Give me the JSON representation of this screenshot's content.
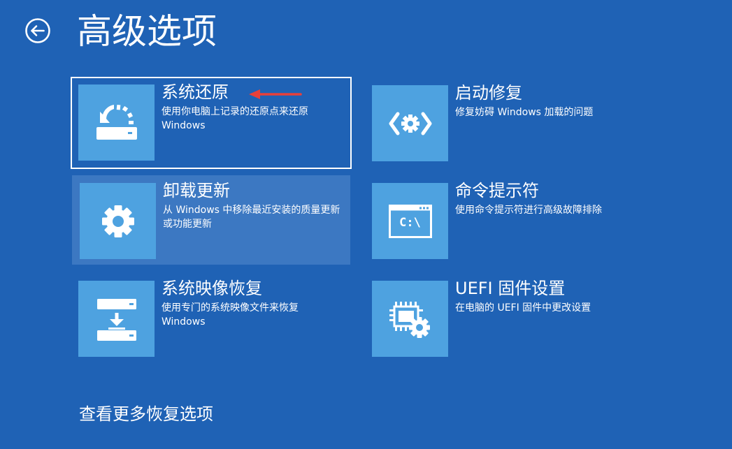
{
  "page": {
    "title": "高级选项",
    "back_icon": "back-arrow-circle-icon"
  },
  "options": [
    {
      "id": "system-restore",
      "title": "系统还原",
      "description": "使用你电脑上记录的还原点来还原 Windows",
      "icon": "system-restore-icon",
      "state": "selected"
    },
    {
      "id": "startup-repair",
      "title": "启动修复",
      "description": "修复妨碍 Windows 加载的问题",
      "icon": "startup-repair-icon",
      "state": "normal"
    },
    {
      "id": "uninstall-updates",
      "title": "卸载更新",
      "description": "从 Windows 中移除最近安装的质量更新或功能更新",
      "icon": "gear-icon",
      "state": "hovered"
    },
    {
      "id": "command-prompt",
      "title": "命令提示符",
      "description": "使用命令提示符进行高级故障排除",
      "icon": "command-prompt-icon",
      "icon_text": "C:\\",
      "state": "normal"
    },
    {
      "id": "system-image-recovery",
      "title": "系统映像恢复",
      "description": "使用专门的系统映像文件来恢复 Windows",
      "icon": "system-image-recovery-icon",
      "state": "normal"
    },
    {
      "id": "uefi-settings",
      "title": "UEFI 固件设置",
      "description": "在电脑的 UEFI 固件中更改设置",
      "icon": "uefi-chip-gear-icon",
      "state": "normal"
    }
  ],
  "more_link": "查看更多恢复选项",
  "colors": {
    "background": "#1f62b5",
    "icon_tile": "#4ea2e0",
    "hover_tile": "#3c78c2",
    "annotation_arrow": "#e8403a",
    "text": "#ffffff"
  }
}
